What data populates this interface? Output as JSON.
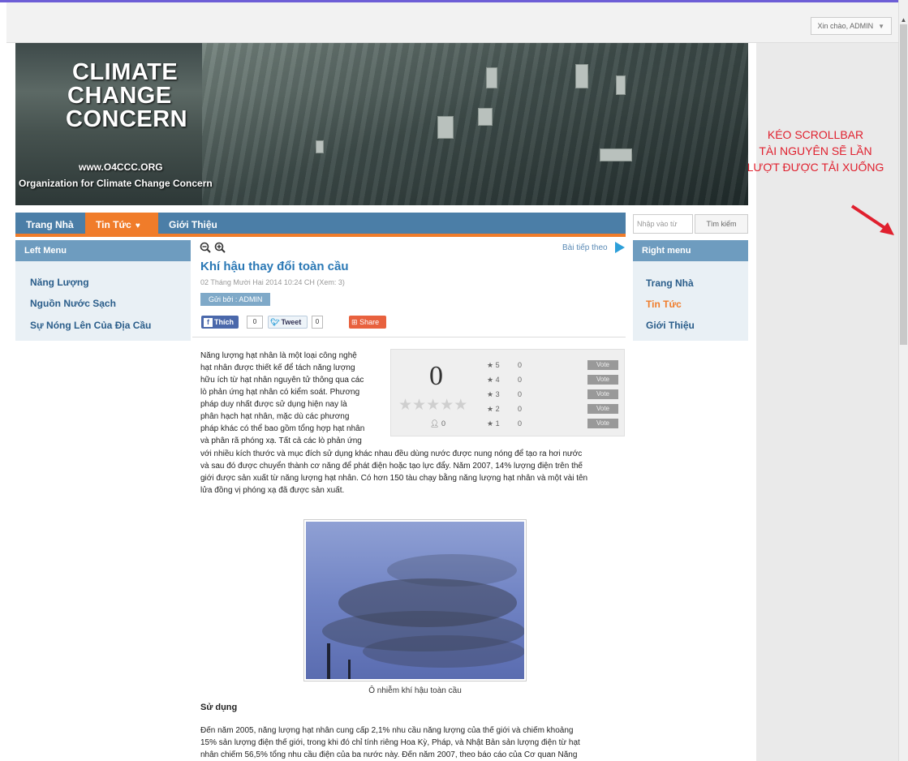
{
  "header": {
    "user_menu": "Xin chào, ADMIN"
  },
  "banner": {
    "title_lines": [
      "CLIMATE",
      "CHANGE",
      "CONCERN"
    ],
    "url": "www.O4CCC.ORG",
    "org": "Organization for Climate Change Concern"
  },
  "annotation": {
    "lines": [
      "KÉO SCROLLBAR",
      "TÀI NGUYÊN SẼ LẦN",
      "LƯỢT ĐƯỢC TẢI XUỐNG"
    ],
    "color": "#e0202e"
  },
  "nav": {
    "items": [
      {
        "label": "Trang Nhà"
      },
      {
        "label": "Tin Tức",
        "icon": "heart-icon"
      },
      {
        "label": "Giới Thiệu"
      }
    ]
  },
  "search": {
    "placeholder": "Nhập vào từ",
    "button": "Tìm kiếm"
  },
  "left_menu": {
    "header": "Left Menu",
    "items": [
      "Năng Lượng",
      "Nguồn Nước Sạch",
      "Sự Nóng Lên Của Địa Cầu"
    ]
  },
  "right_menu": {
    "header": "Right menu",
    "items": [
      "Trang Nhà",
      "Tin Tức",
      "Giới Thiệu"
    ]
  },
  "article": {
    "next_link": "Bài tiếp theo",
    "title": "Khí hậu thay đổi toàn cầu",
    "date": "02 Tháng Mười Hai 2014 10:24 CH (Xem: 3)",
    "author": "Gửi bởi : ADMIN",
    "social": {
      "like": "Thích",
      "like_count": "0",
      "tweet": "Tweet",
      "tweet_count": "0",
      "share": "Share"
    },
    "para1_lines": [
      "Năng lượng hạt nhân là một loại công nghệ",
      "hạt nhân được thiết kế để tách năng lượng",
      "hữu ích từ hạt nhân nguyên tử thông qua các",
      "lò phản ứng hạt nhân có kiểm soát. Phương",
      "pháp duy nhất được sử dụng hiện nay là",
      "phân hạch hạt nhân, mặc dù các phương",
      "pháp khác có thể bao gồm tổng hợp hạt nhân",
      "và phân rã phóng xạ. Tất cả các lò phản ứng"
    ],
    "para2_lines": [
      "với nhiều kích thước và mục đích sử dụng khác nhau đều dùng nước được nung nóng để tạo ra hơi nước",
      "và sau đó được chuyển thành cơ năng để phát điện hoặc tạo lực đẩy. Năm 2007, 14% lượng điện trên thế",
      "giới được sản xuất từ năng lượng hạt nhân. Có hơn 150 tàu chạy bằng năng lượng hạt nhân và một vài tên",
      "lửa đồng vị phóng xạ đã được sản xuất."
    ],
    "caption": "Ô nhiễm khí hậu toàn cầu",
    "section_heading": "Sử dụng",
    "para3_lines": [
      "Đến năm 2005, năng lượng hạt nhân cung cấp 2,1% nhu cầu năng lượng của thế giới và chiếm khoảng",
      "15% sản lượng điện thế giới, trong khi đó chỉ tính riêng Hoa Kỳ, Pháp, và Nhật Bản sản lượng điện từ hạt",
      "nhân chiếm 56,5% tổng nhu cầu điện của ba nước này. Đến năm 2007, theo báo cáo của Cơ quan Năng"
    ]
  },
  "rating": {
    "score": "0",
    "stars": 5,
    "voters": "0",
    "rows": [
      {
        "label": "5",
        "count": "0",
        "vote": "Vote"
      },
      {
        "label": "4",
        "count": "0",
        "vote": "Vote"
      },
      {
        "label": "3",
        "count": "0",
        "vote": "Vote"
      },
      {
        "label": "2",
        "count": "0",
        "vote": "Vote"
      },
      {
        "label": "1",
        "count": "0",
        "vote": "Vote"
      }
    ]
  },
  "colors": {
    "nav_bg": "#4b7ea7",
    "accent": "#f07c2a",
    "link": "#2a5d8a",
    "title": "#2a78b5"
  }
}
